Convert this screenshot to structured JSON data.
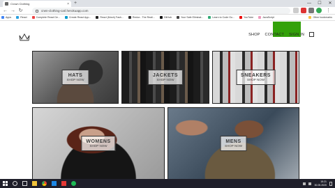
{
  "browser": {
    "tab_title": "Crown Clothing",
    "new_tab_glyph": "+",
    "url": "crwn-clothing-carl.herokuapp.com",
    "window_controls": [
      "—",
      "☐",
      "✕"
    ],
    "bookmarks": [
      {
        "label": "Apps",
        "color": "#4285f4"
      },
      {
        "label": "React",
        "color": "#2aa0e0"
      },
      {
        "label": "Complete React De...",
        "color": "#e44"
      },
      {
        "label": "Create React App...",
        "color": "#09c"
      },
      {
        "label": "React (Mosh) Fash...",
        "color": "#222"
      },
      {
        "label": "Redux - The Reali...",
        "color": "#333"
      },
      {
        "label": "GitHub",
        "color": "#111"
      },
      {
        "label": "Your Safe Eliminat...",
        "color": "#444"
      },
      {
        "label": "Learn to Code Gu...",
        "color": "#3a7"
      },
      {
        "label": "YouTube",
        "color": "#e00"
      },
      {
        "label": "JavaScript",
        "color": "#e9b"
      },
      {
        "label": "Other bookmarks",
        "color": "#f5c242"
      }
    ]
  },
  "site": {
    "nav": {
      "shop": "SHOP",
      "contact": "CONTACT",
      "signin": "SIGN IN"
    },
    "tiles": [
      {
        "title": "HATS",
        "subtitle": "SHOP NOW"
      },
      {
        "title": "JACKETS",
        "subtitle": "SHOP NOW"
      },
      {
        "title": "SNEAKERS",
        "subtitle": "SHOP NOW"
      },
      {
        "title": "WOMENS",
        "subtitle": "SHOP NOW"
      },
      {
        "title": "MENS",
        "subtitle": "SHOP NOW"
      }
    ]
  },
  "taskbar": {
    "time": "15:21",
    "date": "30.05.2020"
  }
}
